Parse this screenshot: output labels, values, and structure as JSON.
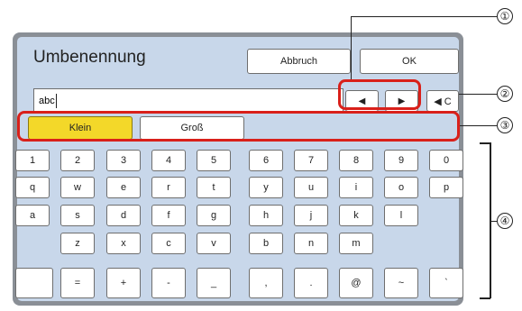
{
  "dialog": {
    "title": "Umbenennung",
    "cancel_label": "Abbruch",
    "ok_label": "OK",
    "input_value": "abc",
    "cursor_left_label": "◀",
    "cursor_right_label": "▶",
    "clear_label": "◀ C"
  },
  "case_tabs": {
    "lower": "Klein",
    "upper": "Groß"
  },
  "keyboard": {
    "row1": [
      "1",
      "2",
      "3",
      "4",
      "5",
      "6",
      "7",
      "8",
      "9",
      "0"
    ],
    "row2": [
      "q",
      "w",
      "e",
      "r",
      "t",
      "y",
      "u",
      "i",
      "o",
      "p"
    ],
    "row3": [
      "a",
      "s",
      "d",
      "f",
      "g",
      "h",
      "j",
      "k",
      "l"
    ],
    "row4": [
      "z",
      "x",
      "c",
      "v",
      "b",
      "n",
      "m"
    ],
    "row5": [
      "",
      "=",
      "+",
      "-",
      "_",
      ",",
      ".",
      "@",
      "~",
      "`"
    ]
  },
  "callouts": [
    "①",
    "②",
    "③",
    "④"
  ],
  "colors": {
    "highlight": "#d9201a",
    "selected_tab": "#f3d829",
    "panel": "#c8d7ea"
  }
}
